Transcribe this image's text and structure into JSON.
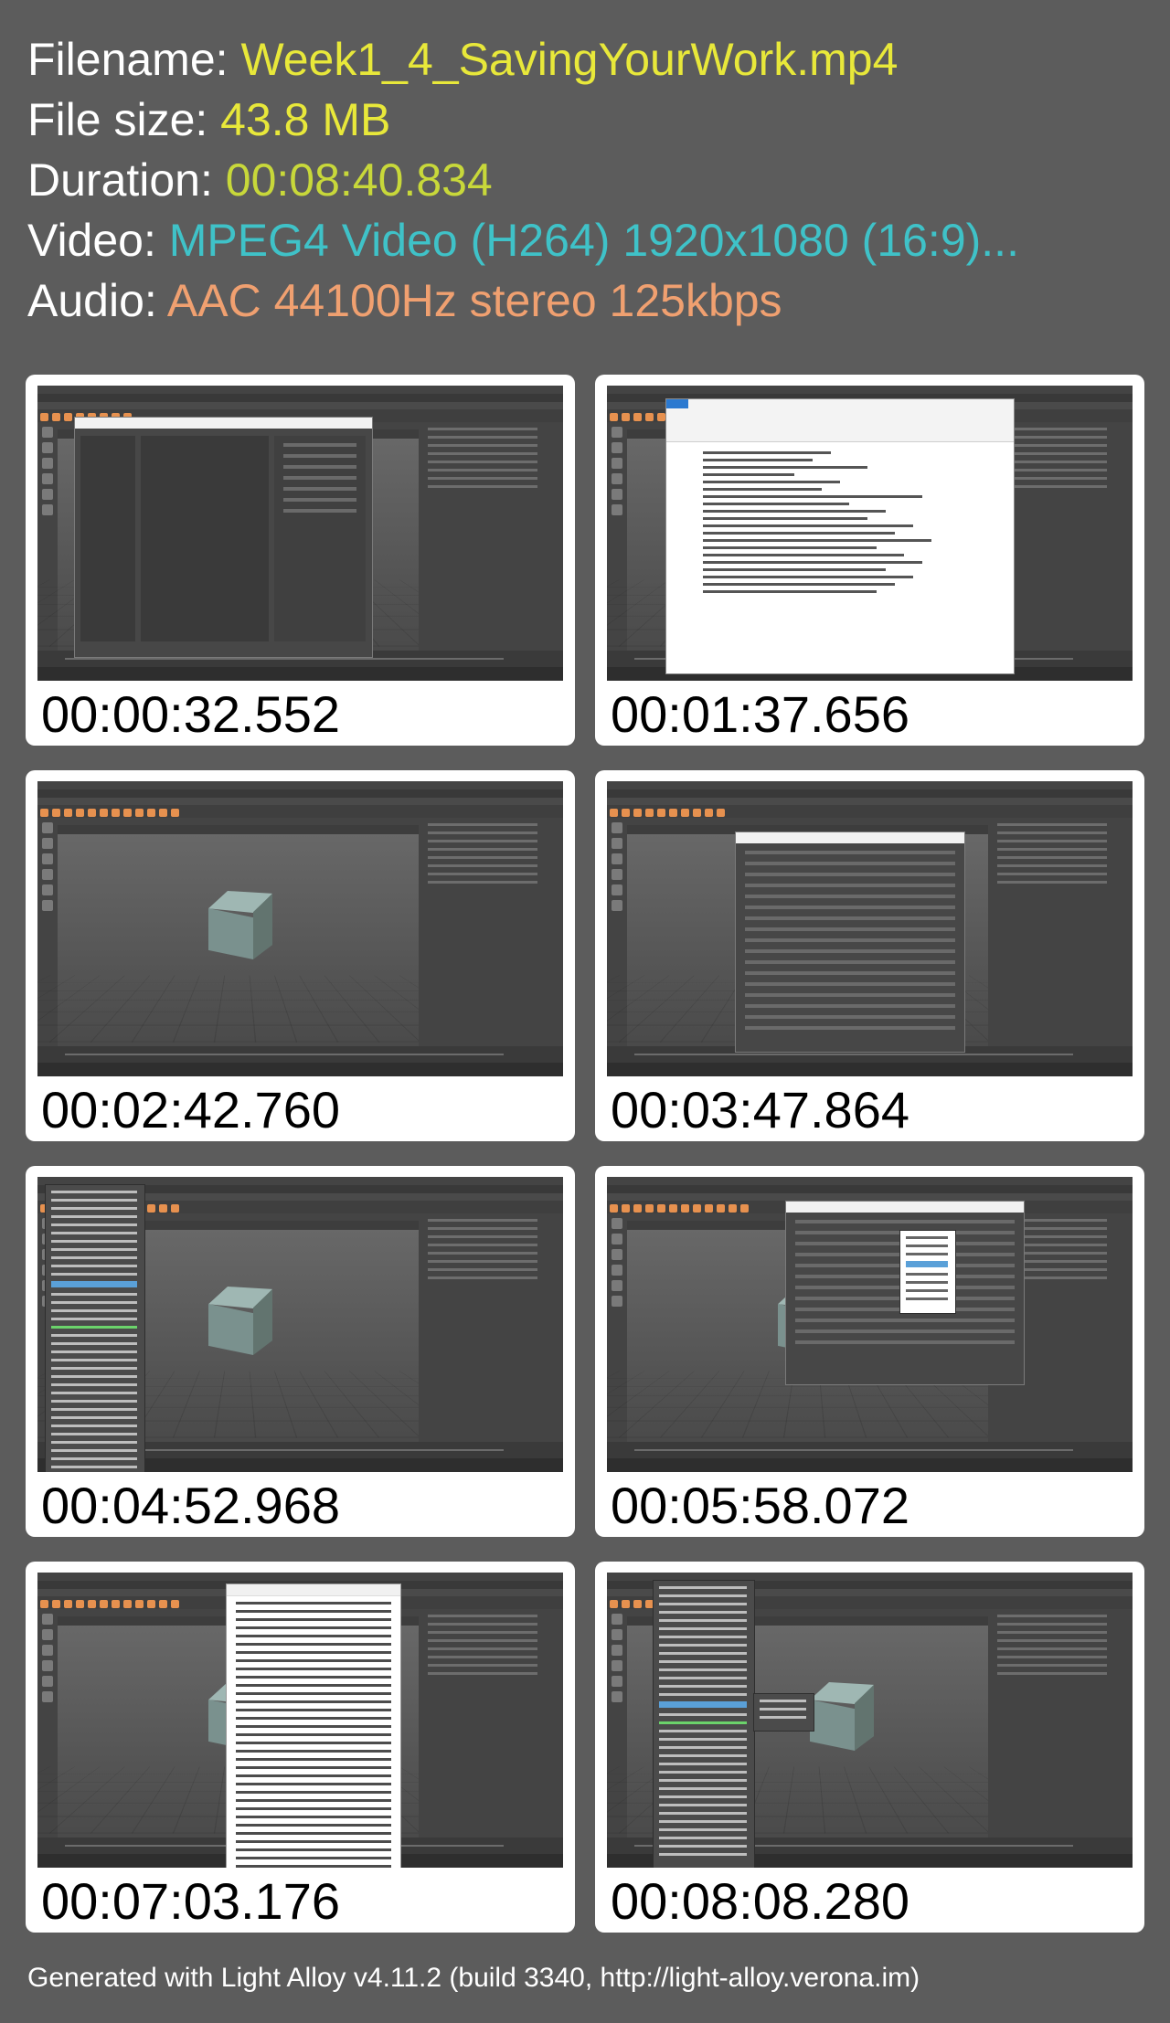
{
  "info": {
    "filename_label": "Filename:",
    "filename_value": "Week1_4_SavingYourWork.mp4",
    "filesize_label": "File size:",
    "filesize_value": "43.8 MB",
    "duration_label": "Duration:",
    "duration_value": "00:08:40.834",
    "video_label": "Video:",
    "video_value": "MPEG4 Video (H264) 1920x1080 (16:9)...",
    "audio_label": "Audio:",
    "audio_value": "AAC 44100Hz stereo 125kbps"
  },
  "colors": {
    "background": "#5c5c5c",
    "label": "#ffffff",
    "filename": "#e8e83a",
    "filesize": "#e8e83a",
    "duration": "#c8d83a",
    "video": "#3fc2c8",
    "audio": "#f0a070"
  },
  "thumbnails": [
    {
      "timestamp": "00:00:32.552",
      "overlay": "save-as-dialog"
    },
    {
      "timestamp": "00:01:37.656",
      "overlay": "wordpad"
    },
    {
      "timestamp": "00:02:42.760",
      "overlay": "none"
    },
    {
      "timestamp": "00:03:47.864",
      "overlay": "project-window"
    },
    {
      "timestamp": "00:04:52.968",
      "overlay": "file-menu"
    },
    {
      "timestamp": "00:05:58.072",
      "overlay": "export-selection-options"
    },
    {
      "timestamp": "00:07:03.176",
      "overlay": "plugin-manager"
    },
    {
      "timestamp": "00:08:08.280",
      "overlay": "file-menu-send-to"
    }
  ],
  "footer": "Generated with Light Alloy v4.11.2 (build 3340, http://light-alloy.verona.im)"
}
